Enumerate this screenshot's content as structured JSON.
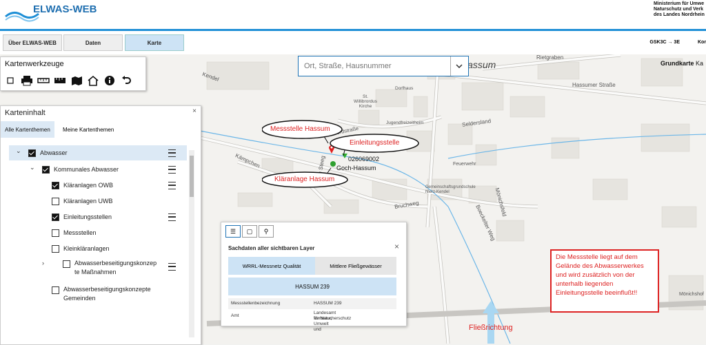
{
  "header": {
    "logo_text": "ELWAS-WEB",
    "ministry_lines": [
      "Ministerium für Umwe",
      "Naturschutz und Verk",
      "des Landes Nordrhein"
    ]
  },
  "nav": {
    "buttons": [
      "Über ELWAS-WEB",
      "Daten",
      "Karte"
    ],
    "crs": "GSK3C → 3E",
    "kon": "Kon"
  },
  "search": {
    "placeholder": "Ort, Straße, Hausnummer"
  },
  "basemap": {
    "label": "Grundkarte",
    "value": "Ka"
  },
  "tools": {
    "title": "Kartenwerkzeuge",
    "icons": [
      "square-select-icon",
      "print-icon",
      "measure-icon",
      "ruler-icon",
      "map-export-icon",
      "home-icon",
      "info-icon",
      "undo-icon"
    ]
  },
  "content": {
    "title": "Karteninhalt",
    "close": "×",
    "tabs": [
      "Alle Kartenthemen",
      "Meine Kartenthemen"
    ],
    "tree": [
      {
        "label": "Abwasser",
        "checked": true
      },
      {
        "label": "Kommunales Abwasser",
        "checked": true
      },
      {
        "label": "Kläranlagen OWB",
        "checked": true
      },
      {
        "label": "Kläranlagen UWB",
        "checked": false
      },
      {
        "label": "Einleitungsstellen",
        "checked": true
      },
      {
        "label": "Messstellen",
        "checked": false
      },
      {
        "label": "Kleinkläranlagen",
        "checked": false
      },
      {
        "label": "Abwasserbeseitigungskonzepte Maßnahmen",
        "line1": "Abwasserbeseitigungskonzep",
        "line2": "te Maßnahmen",
        "checked": false
      },
      {
        "label": "Abwasserbeseitigungskonzepte Gemeinden",
        "line1": "Abwasserbeseitigungskonzepte",
        "line2": "Gemeinden",
        "checked": false
      }
    ]
  },
  "popup": {
    "title": "Sachdaten aller sichtbaren Layer",
    "close": "×",
    "layer_tabs": [
      "WRRL-Messnetz Qualität",
      "Mittlere Fließgewässer"
    ],
    "station": "HASSUM 239",
    "rows": [
      {
        "key": "Messstellenbezeichnung",
        "value": "HASSUM 239"
      },
      {
        "key": "Amt",
        "value_line1": "Landesamt für Natur, Umwelt und",
        "value_line2": "Verbraucherschutz"
      }
    ]
  },
  "map": {
    "place": "Hassum",
    "streets": [
      "Rietgraben",
      "Hassumer Straße",
      "Kendel",
      "Willibrordstraße",
      "Seldersland",
      "Kämpchen",
      "Am Steeg",
      "Bruchweg",
      "Feuerwehr",
      "Gemeinschaftsgrundschule Nierz-Kendel",
      "Boeckelter Weg",
      "Mönichsfeld",
      "Dorfhaus",
      "St. Willibrordus Kirche",
      "Jugendfreizeitheim",
      "Mönichshof"
    ],
    "marker_ids": [
      "026069002",
      "Goch-Hassum"
    ]
  },
  "callouts": {
    "messstelle": "Messstelle Hassum",
    "einleitung": "Einleitungsstelle",
    "klaeranlage": "Kläranlage Hassum",
    "fliessrichtung": "Fließrichtung"
  },
  "note": "Die Messstelle liegt auf dem Gelände des Abwasserwerkes und wird zusätzlich von der unterhalb liegenden Einleitungsstelle beeinflußt!!",
  "colors": {
    "accent": "#1f8fd6",
    "highlight": "#cde3f5",
    "annotation": "#dd2222"
  }
}
